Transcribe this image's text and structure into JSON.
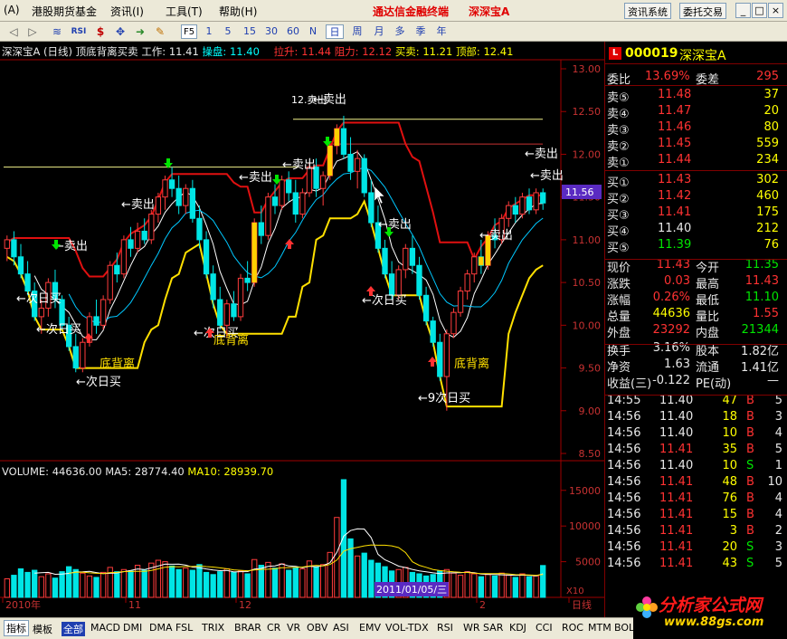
{
  "menu": {
    "items": [
      "(A)",
      "港股期货基金",
      "资讯(I)",
      "工具(T)",
      "帮助(H)"
    ],
    "app_title": "通达信金融终端",
    "stock_title": "深深宝A",
    "btn_info": "资讯系统",
    "btn_trade": "委托交易",
    "win_min": "_",
    "win_max": "□",
    "win_close": "×"
  },
  "toolbar": {
    "periods": [
      "1",
      "5",
      "15",
      "30",
      "60",
      "N",
      "日",
      "周",
      "月",
      "多",
      "季",
      "年"
    ],
    "active_period": "日",
    "fs_label": "F5"
  },
  "chart_header": {
    "name": "深深宝A (日线) 顶底背离买卖",
    "work_label": "工作:",
    "work_value": "11.41",
    "op_label": "操盘:",
    "op_value": "11.40",
    "pull_label": "拉升:",
    "pull_value": "11.44",
    "resist_label": "阻力:",
    "resist_value": "12.12",
    "buy_label": "买卖:",
    "buy_value": "11.21",
    "top_label": "顶部:",
    "top_value": "12.41"
  },
  "price_axis": {
    "ticks": [
      "13.00",
      "12.50",
      "12.00",
      "11.50",
      "11.00",
      "10.50",
      "10.00",
      "9.50",
      "9.00",
      "8.50"
    ],
    "current_tag": "11.56"
  },
  "annotations": {
    "sell": [
      "卖出",
      "卖出",
      "卖出",
      "卖出",
      "卖出",
      "卖出",
      "卖出",
      "卖出",
      "卖出"
    ],
    "high_marker": "12.卖出",
    "next_day_buy": [
      "次日买",
      "次日买",
      "次日买",
      "次日买",
      "次日买",
      "9次日买"
    ],
    "bottom_div": [
      "底背离",
      "底背离",
      "底背离"
    ]
  },
  "volume_header": {
    "vol_label": "VOLUME:",
    "vol_value": "44636.00",
    "ma5_label": "MA5:",
    "ma5_value": "28774.40",
    "ma10_label": "MA10:",
    "ma10_value": "28939.70"
  },
  "volume_axis": {
    "ticks": [
      "15000",
      "10000",
      "5000"
    ],
    "unit": "X10"
  },
  "date_axis": {
    "labels": [
      "2010年",
      "11",
      "12",
      "2",
      "日线"
    ],
    "cursor_date": "2011/01/05/三"
  },
  "quote": {
    "code": "000019",
    "name": "深深宝A",
    "wb_label": "委比",
    "wb_value": "13.69%",
    "wc_label": "委差",
    "wc_value": "295",
    "asks": [
      {
        "label": "卖⑤",
        "price": "11.48",
        "vol": "37"
      },
      {
        "label": "卖④",
        "price": "11.47",
        "vol": "20"
      },
      {
        "label": "卖③",
        "price": "11.46",
        "vol": "80"
      },
      {
        "label": "卖②",
        "price": "11.45",
        "vol": "559"
      },
      {
        "label": "卖①",
        "price": "11.44",
        "vol": "234"
      }
    ],
    "bids": [
      {
        "label": "买①",
        "price": "11.43",
        "vol": "302"
      },
      {
        "label": "买②",
        "price": "11.42",
        "vol": "460"
      },
      {
        "label": "买③",
        "price": "11.41",
        "vol": "175"
      },
      {
        "label": "买④",
        "price": "11.40",
        "vol": "212"
      },
      {
        "label": "买⑤",
        "price": "11.39",
        "vol": "76"
      }
    ],
    "stats": [
      {
        "l1": "现价",
        "v1": "11.43",
        "c1": "red",
        "l2": "今开",
        "v2": "11.35",
        "c2": "grn"
      },
      {
        "l1": "涨跌",
        "v1": "0.03",
        "c1": "red",
        "l2": "最高",
        "v2": "11.43",
        "c2": "red"
      },
      {
        "l1": "涨幅",
        "v1": "0.26%",
        "c1": "red",
        "l2": "最低",
        "v2": "11.10",
        "c2": "grn"
      },
      {
        "l1": "总量",
        "v1": "44636",
        "c1": "yel",
        "l2": "量比",
        "v2": "1.55",
        "c2": "red"
      },
      {
        "l1": "外盘",
        "v1": "23292",
        "c1": "red",
        "l2": "内盘",
        "v2": "21344",
        "c2": "grn"
      }
    ],
    "stats2": [
      {
        "l1": "换手",
        "v1": "3.16%",
        "l2": "股本",
        "v2": "1.82亿"
      },
      {
        "l1": "净资",
        "v1": "1.63",
        "l2": "流通",
        "v2": "1.41亿"
      },
      {
        "l1": "收益(三)",
        "v1": "-0.122",
        "l2": "PE(动)",
        "v2": "—"
      }
    ],
    "ticks": [
      {
        "time": "14:55",
        "price": "11.40",
        "pc": "wht",
        "vol": "47",
        "side": "B",
        "n": "5"
      },
      {
        "time": "14:56",
        "price": "11.40",
        "pc": "wht",
        "vol": "18",
        "side": "B",
        "n": "3"
      },
      {
        "time": "14:56",
        "price": "11.40",
        "pc": "wht",
        "vol": "10",
        "side": "B",
        "n": "4"
      },
      {
        "time": "14:56",
        "price": "11.41",
        "pc": "red",
        "vol": "35",
        "side": "B",
        "n": "5"
      },
      {
        "time": "14:56",
        "price": "11.40",
        "pc": "wht",
        "vol": "10",
        "side": "S",
        "n": "1"
      },
      {
        "time": "14:56",
        "price": "11.41",
        "pc": "red",
        "vol": "48",
        "side": "B",
        "n": "10"
      },
      {
        "time": "14:56",
        "price": "11.41",
        "pc": "red",
        "vol": "76",
        "side": "B",
        "n": "4"
      },
      {
        "time": "14:56",
        "price": "11.41",
        "pc": "red",
        "vol": "15",
        "side": "B",
        "n": "4"
      },
      {
        "time": "14:56",
        "price": "11.41",
        "pc": "red",
        "vol": "3",
        "side": "B",
        "n": "2"
      },
      {
        "time": "14:56",
        "price": "11.41",
        "pc": "red",
        "vol": "20",
        "side": "S",
        "n": "3"
      },
      {
        "time": "14:56",
        "price": "11.41",
        "pc": "red",
        "vol": "43",
        "side": "S",
        "n": "5"
      }
    ]
  },
  "bottom_tabs": [
    "指标",
    "模板",
    "全部",
    "MACD",
    "DMI",
    "DMA",
    "FSL",
    "TRIX",
    "BRAR",
    "CR",
    "VR",
    "OBV",
    "ASI",
    "EMV",
    "VOL-TDX",
    "RSI",
    "WR",
    "SAR",
    "KDJ",
    "CCI",
    "ROC",
    "MTM",
    "BOLL"
  ],
  "logo": {
    "line1": "分析家公式网",
    "line2": "www.88gs.com"
  },
  "chart_data": {
    "type": "candlestick",
    "price_range": [
      8.5,
      13.0
    ],
    "volume_range": [
      0,
      17000
    ],
    "candles": [
      [
        10.9,
        11.05,
        10.75,
        11.0
      ],
      [
        11.0,
        11.1,
        10.7,
        10.8
      ],
      [
        10.8,
        10.95,
        10.55,
        10.6
      ],
      [
        10.6,
        10.75,
        10.35,
        10.4
      ],
      [
        10.4,
        10.5,
        10.05,
        10.1
      ],
      [
        10.1,
        10.3,
        9.9,
        10.2
      ],
      [
        10.2,
        10.55,
        10.1,
        10.5
      ],
      [
        10.5,
        10.65,
        10.2,
        10.3
      ],
      [
        10.3,
        10.35,
        9.95,
        10.0
      ],
      [
        10.0,
        10.1,
        9.7,
        9.75
      ],
      [
        9.75,
        9.9,
        9.45,
        9.5
      ],
      [
        9.5,
        9.85,
        9.45,
        9.8
      ],
      [
        9.8,
        10.15,
        9.75,
        10.1
      ],
      [
        10.1,
        10.3,
        9.9,
        10.0
      ],
      [
        10.0,
        10.35,
        9.95,
        10.3
      ],
      [
        10.3,
        10.75,
        10.25,
        10.7
      ],
      [
        10.7,
        10.85,
        10.5,
        10.6
      ],
      [
        10.6,
        11.05,
        10.55,
        11.0
      ],
      [
        11.0,
        11.15,
        10.8,
        10.9
      ],
      [
        10.9,
        11.2,
        10.85,
        11.1
      ],
      [
        11.1,
        11.25,
        10.95,
        11.0
      ],
      [
        11.0,
        11.35,
        10.95,
        11.3
      ],
      [
        11.3,
        11.55,
        11.2,
        11.5
      ],
      [
        11.5,
        11.75,
        11.35,
        11.7
      ],
      [
        11.7,
        11.85,
        11.5,
        11.6
      ],
      [
        11.6,
        11.75,
        11.3,
        11.4
      ],
      [
        11.4,
        11.65,
        11.3,
        11.6
      ],
      [
        11.6,
        11.7,
        11.2,
        11.25
      ],
      [
        11.25,
        11.4,
        10.9,
        11.0
      ],
      [
        11.0,
        11.1,
        10.55,
        10.6
      ],
      [
        10.6,
        10.7,
        10.2,
        10.3
      ],
      [
        10.3,
        10.45,
        9.95,
        10.0
      ],
      [
        10.0,
        10.3,
        9.85,
        10.25
      ],
      [
        10.25,
        10.4,
        10.05,
        10.1
      ],
      [
        10.1,
        10.6,
        10.05,
        10.55
      ],
      [
        10.55,
        10.75,
        10.4,
        10.5
      ],
      [
        10.5,
        11.25,
        10.45,
        11.2
      ],
      [
        11.2,
        11.4,
        10.95,
        11.05
      ],
      [
        11.05,
        11.55,
        11.0,
        11.5
      ],
      [
        11.5,
        11.65,
        11.3,
        11.4
      ],
      [
        11.4,
        11.75,
        11.35,
        11.7
      ],
      [
        11.7,
        11.8,
        11.45,
        11.55
      ],
      [
        11.55,
        11.7,
        11.2,
        11.3
      ],
      [
        11.3,
        11.6,
        11.25,
        11.55
      ],
      [
        11.55,
        11.9,
        11.5,
        11.85
      ],
      [
        11.85,
        11.95,
        11.5,
        11.6
      ],
      [
        11.6,
        11.8,
        11.4,
        11.75
      ],
      [
        11.75,
        12.15,
        11.7,
        12.1
      ],
      [
        12.1,
        12.35,
        12.0,
        12.3
      ],
      [
        12.3,
        12.45,
        11.95,
        12.0
      ],
      [
        12.0,
        12.2,
        11.7,
        11.8
      ],
      [
        11.8,
        12.05,
        11.6,
        11.95
      ],
      [
        11.95,
        12.0,
        11.5,
        11.55
      ],
      [
        11.55,
        11.7,
        11.15,
        11.2
      ],
      [
        11.2,
        11.4,
        10.85,
        10.9
      ],
      [
        10.9,
        11.0,
        10.55,
        10.6
      ],
      [
        10.6,
        10.75,
        10.3,
        10.35
      ],
      [
        10.35,
        10.7,
        10.3,
        10.65
      ],
      [
        10.65,
        10.95,
        10.55,
        10.9
      ],
      [
        10.9,
        11.05,
        10.6,
        10.7
      ],
      [
        10.7,
        10.8,
        10.3,
        10.35
      ],
      [
        10.35,
        10.45,
        10.0,
        10.05
      ],
      [
        10.05,
        10.1,
        9.75,
        9.8
      ],
      [
        9.8,
        9.9,
        9.35,
        9.4
      ],
      [
        9.4,
        9.95,
        9.0,
        9.9
      ],
      [
        9.9,
        10.2,
        9.85,
        10.15
      ],
      [
        10.15,
        10.45,
        10.1,
        10.4
      ],
      [
        10.4,
        10.65,
        10.3,
        10.6
      ],
      [
        10.6,
        10.85,
        10.5,
        10.8
      ],
      [
        10.8,
        11.0,
        10.6,
        10.7
      ],
      [
        10.7,
        11.1,
        10.65,
        11.05
      ],
      [
        11.05,
        11.25,
        10.9,
        11.0
      ],
      [
        11.0,
        11.3,
        10.95,
        11.25
      ],
      [
        11.25,
        11.45,
        11.15,
        11.4
      ],
      [
        11.4,
        11.5,
        11.2,
        11.3
      ],
      [
        11.3,
        11.55,
        11.25,
        11.5
      ],
      [
        11.5,
        11.6,
        11.3,
        11.35
      ],
      [
        11.35,
        11.6,
        11.3,
        11.55
      ],
      [
        11.55,
        11.6,
        11.35,
        11.43
      ]
    ],
    "volumes": [
      2600,
      3100,
      4000,
      3500,
      3800,
      2900,
      3300,
      2700,
      3600,
      4300,
      3900,
      3400,
      3000,
      2800,
      3500,
      4200,
      3600,
      3900,
      3700,
      4500,
      3800,
      4800,
      5200,
      5000,
      4400,
      3900,
      4100,
      3800,
      4600,
      3500,
      3200,
      3600,
      4000,
      3500,
      3700,
      3300,
      5300,
      4500,
      4900,
      4100,
      4700,
      3800,
      4200,
      4000,
      5100,
      4300,
      4600,
      6300,
      11200,
      16500,
      8200,
      5800,
      6200,
      5200,
      4800,
      4300,
      3700,
      3900,
      4200,
      3500,
      3300,
      3000,
      3200,
      3700,
      3900,
      3400,
      3100,
      3600,
      3300,
      2900,
      3200,
      3000,
      3400,
      3100,
      2800,
      3300,
      2900,
      3000,
      4464
    ],
    "annotations_note": "sell/next-day-buy/bottom-divergence markers"
  }
}
